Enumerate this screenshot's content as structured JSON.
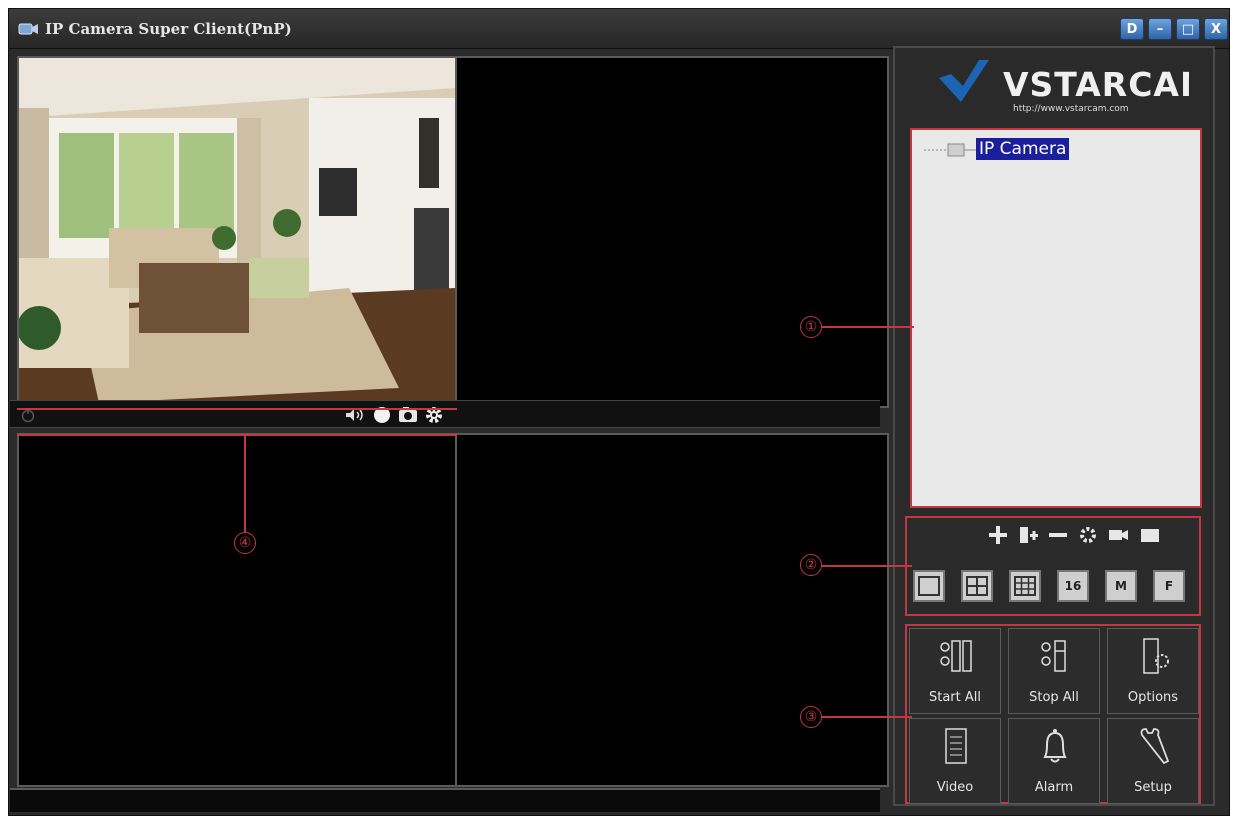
{
  "window": {
    "title": "IP Camera Super Client(PnP)",
    "title_buttons": [
      "D",
      "–",
      "□",
      "X"
    ]
  },
  "logo": {
    "brand": "VSTARCAM",
    "url": "http://www.vstarcam.com"
  },
  "device_tree": {
    "root_label": "IP Camera"
  },
  "toolbar_icons": [
    "add-icon",
    "add-device-icon",
    "remove-icon",
    "settings-icon",
    "record-icon",
    "fullscreen-icon"
  ],
  "layouts": [
    "1",
    "4",
    "9",
    "16",
    "M",
    "F"
  ],
  "action_buttons": {
    "start_all": "Start All",
    "stop_all": "Stop All",
    "options": "Options",
    "video": "Video",
    "alarm": "Alarm",
    "setup": "Setup"
  },
  "annotations": [
    "①",
    "②",
    "③",
    "④"
  ],
  "colors": {
    "annotation": "#c43742",
    "tree_selection": "#1b1f9c",
    "title_button": "#4a7fc0"
  }
}
